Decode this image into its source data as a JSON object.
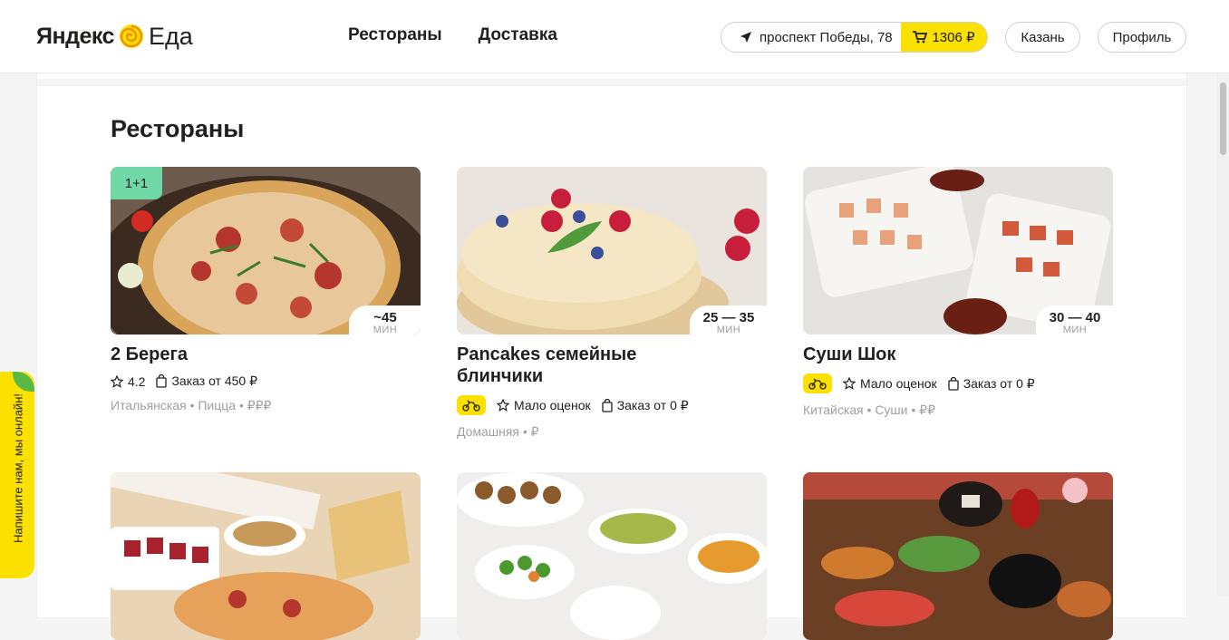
{
  "header": {
    "logo_yandex": "Яндекс",
    "logo_eda": "Еда",
    "nav": [
      "Рестораны",
      "Доставка"
    ],
    "address": "проспект Победы, 78",
    "cart_total": "1306 ₽",
    "city": "Казань",
    "profile": "Профиль"
  },
  "page_title": "Рестораны",
  "cards": [
    {
      "name": "2 Берега",
      "promo": "1+1",
      "time": "~45",
      "time_unit": "МИН",
      "rating": "4.2",
      "min_order": "Заказ от 450 ₽",
      "tags": "Итальянская • Пицца • ₽₽₽"
    },
    {
      "name": "Pancakes семейные блинчики",
      "time": "25 — 35",
      "time_unit": "МИН",
      "rating": "Мало оценок",
      "min_order": "Заказ от 0 ₽",
      "tags": "Домашняя • ₽"
    },
    {
      "name": "Суши Шок",
      "time": "30 — 40",
      "time_unit": "МИН",
      "rating": "Мало оценок",
      "min_order": "Заказ от 0 ₽",
      "tags": "Китайская • Суши • ₽₽"
    }
  ],
  "feedback_tab": "Напишите нам, мы онлайн!",
  "colors": {
    "accent": "#fce000",
    "promo": "#6fd8a6"
  }
}
